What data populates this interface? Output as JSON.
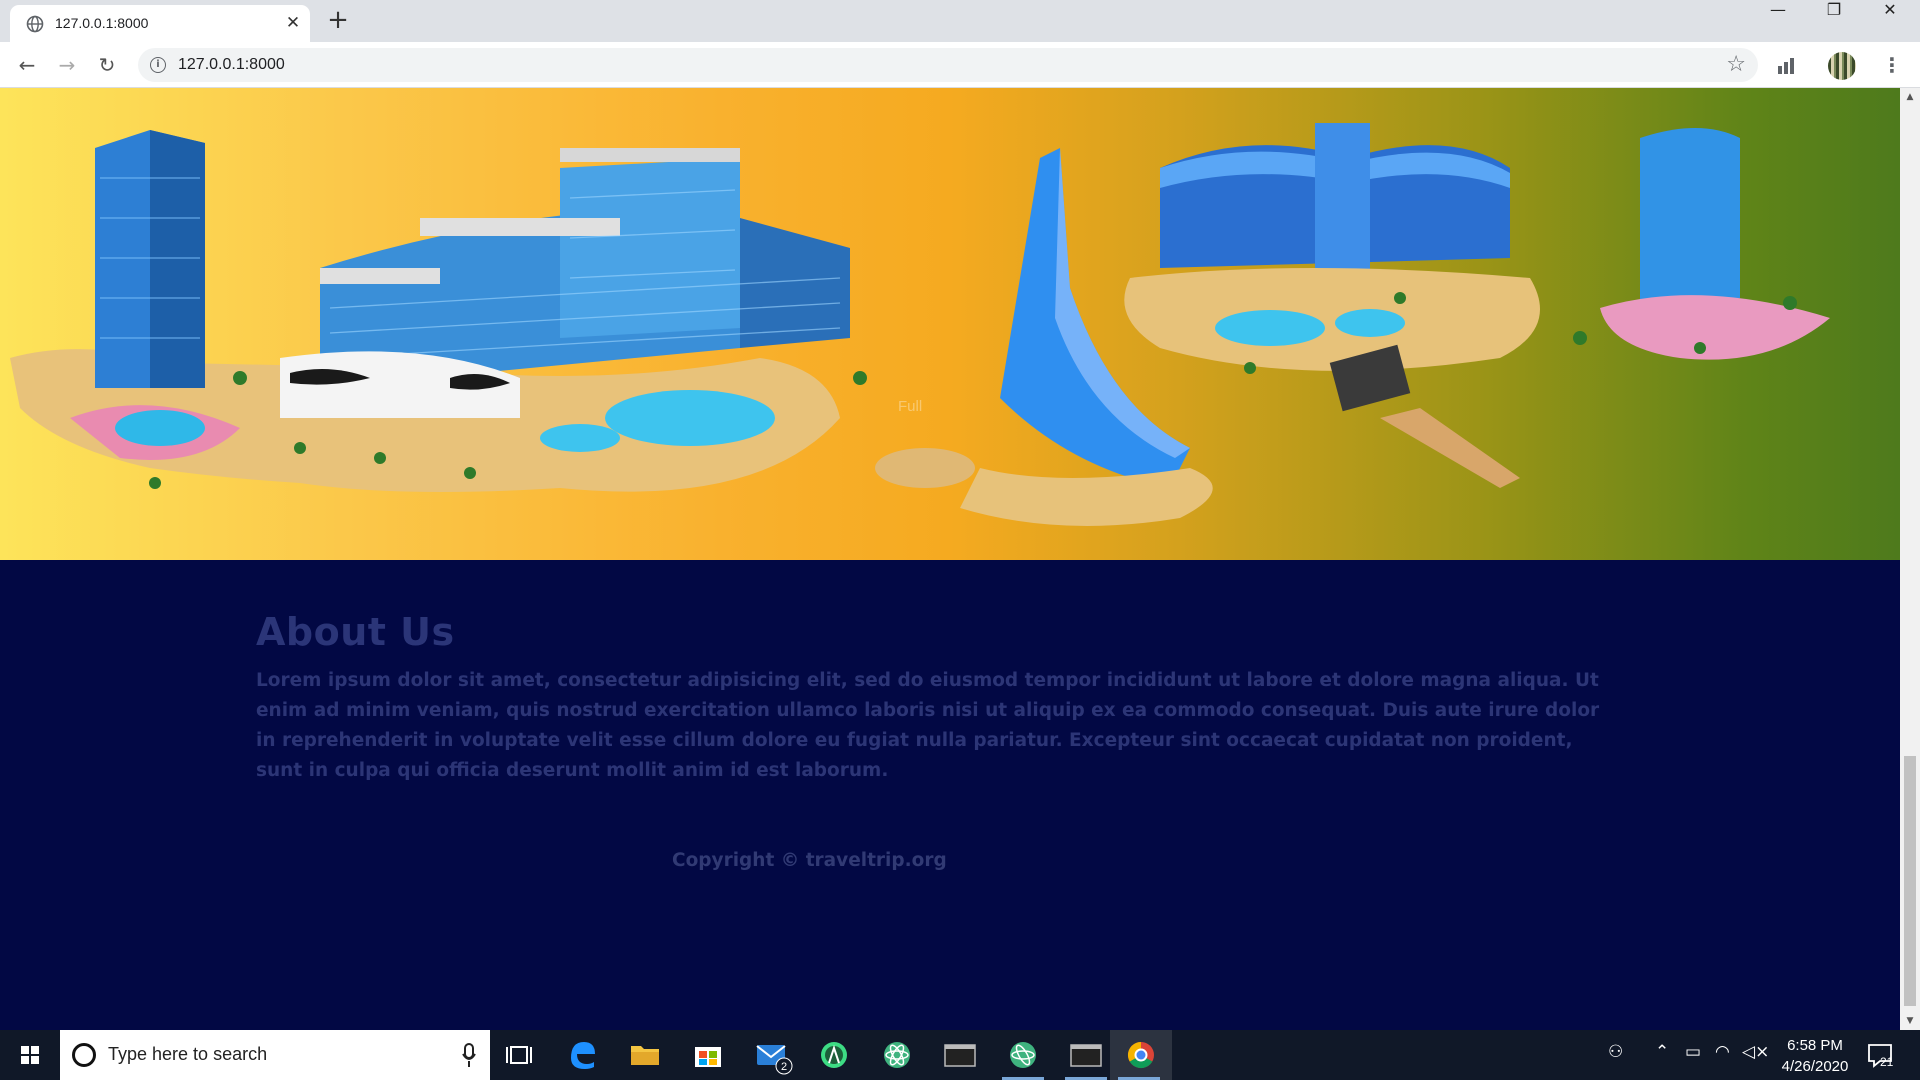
{
  "browser": {
    "tab_title": "127.0.0.1:8000",
    "tab_close": "✕",
    "new_tab": "+",
    "url": "127.0.0.1:8000",
    "window_controls": {
      "minimize": "—",
      "maximize": "❐",
      "close": "✕"
    },
    "nav": {
      "back": "←",
      "forward": "→",
      "reload": "↻"
    },
    "star": "☆",
    "menu": "⋮"
  },
  "hero": {
    "ghost_text": "Full"
  },
  "about": {
    "title": "About Us",
    "text": "Lorem ipsum dolor sit amet, consectetur adipisicing elit, sed do eiusmod tempor incididunt ut labore et dolore magna aliqua. Ut enim ad minim veniam, quis nostrud exercitation ullamco laboris nisi ut aliquip ex ea commodo consequat. Duis aute irure dolor in reprehenderit in voluptate velit esse cillum dolore eu fugiat nulla pariatur. Excepteur sint occaecat cupidatat non proident, sunt in culpa qui officia deserunt mollit anim id est laborum.",
    "copyright": "Copyright © traveltrip.org"
  },
  "taskbar": {
    "search_placeholder": "Type here to search",
    "mail_badge": "2",
    "time": "6:58 PM",
    "date": "4/26/2020",
    "notification_count": "21"
  },
  "colors": {
    "footer_bg": "#020844",
    "footer_text": "#2c3576",
    "hero_left": "#fde45a",
    "hero_mid": "#f5aa20",
    "hero_right": "#4e7a1c"
  }
}
